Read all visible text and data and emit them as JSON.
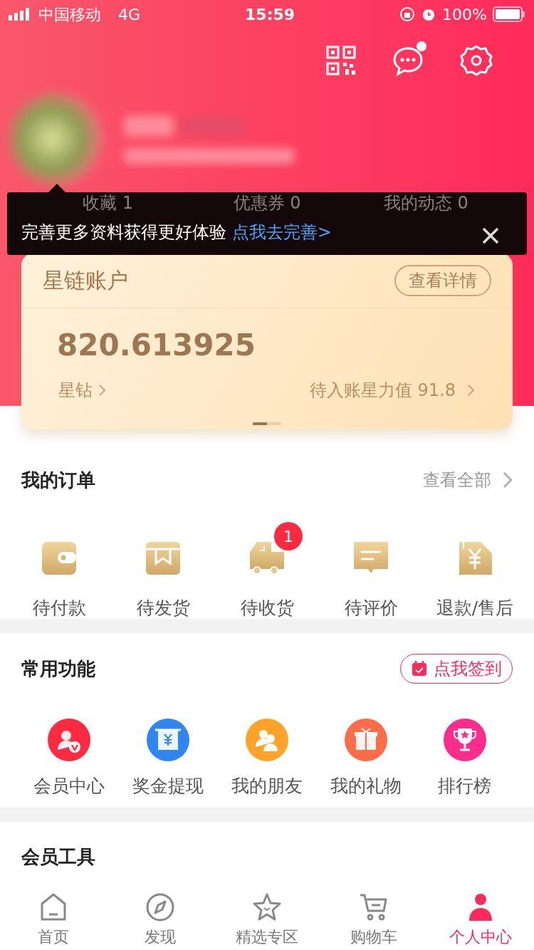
{
  "status_bar": {
    "carrier": "中国移动",
    "network": "4G",
    "time": "15:59",
    "battery": "100%"
  },
  "header": {
    "message_unread": true
  },
  "profile": {
    "stats": [
      {
        "label": "收藏",
        "value": "1"
      },
      {
        "label": "优惠券",
        "value": "0"
      },
      {
        "label": "我的动态",
        "value": "0"
      }
    ]
  },
  "tooltip": {
    "text": "完善更多资料获得更好体验",
    "link": "点我去完善>"
  },
  "account_card": {
    "title": "星链账户",
    "details_button": "查看详情",
    "balance": "820.613925",
    "left_link": "星钻",
    "right_link": "待入账星力值 91.8",
    "pages": [
      {
        "selected": true
      },
      {
        "selected": false
      }
    ]
  },
  "orders": {
    "title": "我的订单",
    "view_all": "查看全部",
    "items": [
      {
        "label": "待付款"
      },
      {
        "label": "待发货"
      },
      {
        "label": "待收货",
        "badge": "1"
      },
      {
        "label": "待评价"
      },
      {
        "label": "退款/售后"
      }
    ]
  },
  "functions": {
    "title": "常用功能",
    "sign_in_button": "点我签到",
    "items": [
      {
        "label": "会员中心",
        "color": "#fc2b41"
      },
      {
        "label": "奖金提现",
        "color": "#2f86ee"
      },
      {
        "label": "我的朋友",
        "color": "#fea32a"
      },
      {
        "label": "我的礼物",
        "color": "#fd6d4a"
      },
      {
        "label": "排行榜",
        "color": "#fc2d8d"
      }
    ]
  },
  "tools": {
    "title": "会员工具"
  },
  "tab_bar": [
    {
      "label": "首页",
      "selected": false
    },
    {
      "label": "发现",
      "selected": false
    },
    {
      "label": "精选专区",
      "selected": false
    },
    {
      "label": "购物车",
      "selected": false
    },
    {
      "label": "个人中心",
      "selected": true
    }
  ]
}
